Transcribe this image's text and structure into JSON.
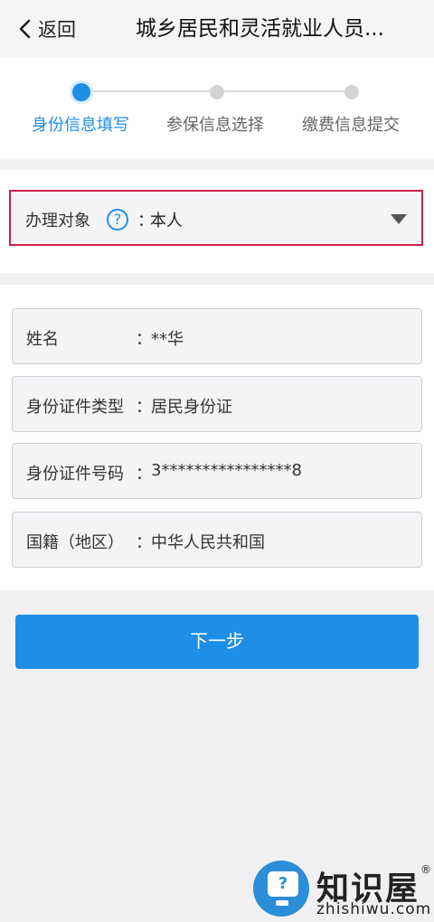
{
  "header": {
    "back_label": "返回",
    "title": "城乡居民和灵活就业人员..."
  },
  "steps": [
    {
      "label": "身份信息填写",
      "active": true
    },
    {
      "label": "参保信息选择",
      "active": false
    },
    {
      "label": "缴费信息提交",
      "active": false
    }
  ],
  "target": {
    "label": "办理对象",
    "help_glyph": "?",
    "colon": "：",
    "value": "本人"
  },
  "fields": [
    {
      "label": "姓名",
      "colon": "：",
      "value": "**华"
    },
    {
      "label": "身份证件类型",
      "colon": "：",
      "value": "居民身份证"
    },
    {
      "label": "身份证件号码",
      "colon": "：",
      "value": "3****************8"
    },
    {
      "label": "国籍（地区）",
      "colon": "：",
      "value": "中华人民共和国"
    }
  ],
  "next_button": {
    "label": "下一步"
  },
  "watermark": {
    "icon_glyph": "?",
    "name": "知识屋",
    "registered": "®",
    "domain": "zhishiwu.com"
  },
  "colors": {
    "accent": "#1e8fe8",
    "highlight_border": "#d1204a",
    "background": "#f0f0f2"
  }
}
